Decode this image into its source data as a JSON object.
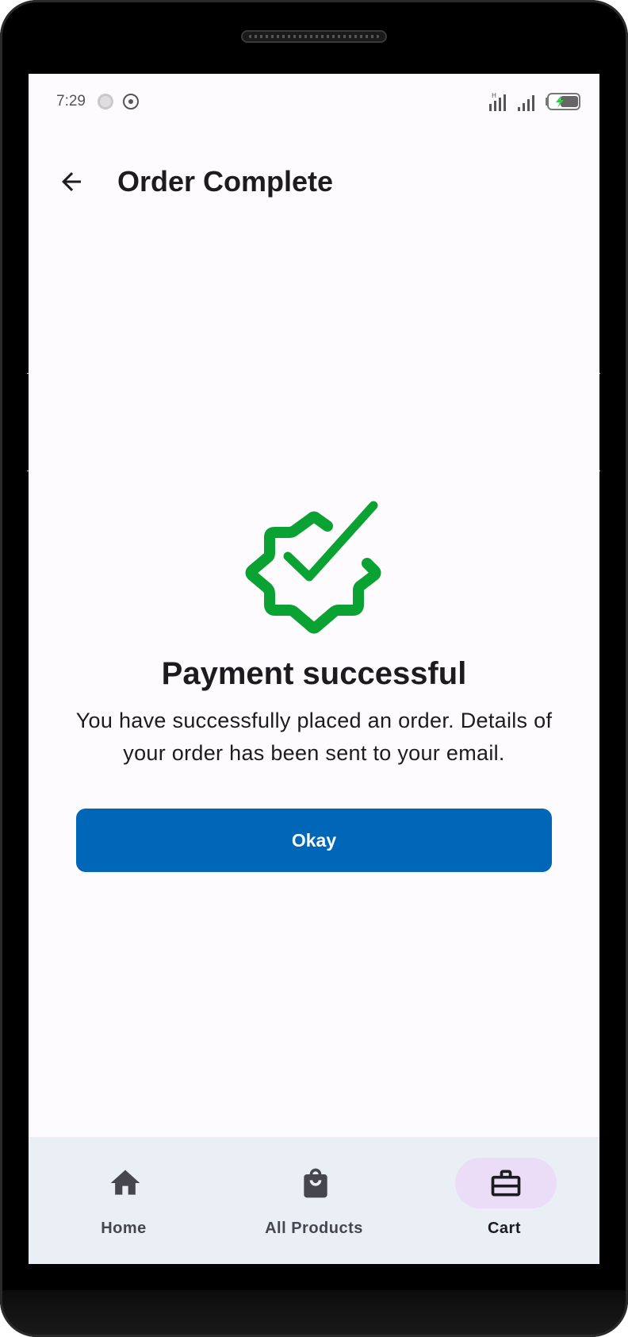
{
  "status_bar": {
    "time": "7:29"
  },
  "app_bar": {
    "title": "Order Complete",
    "back_icon": "arrow-left-icon"
  },
  "success": {
    "icon": "verified-badge-check-icon",
    "icon_color": "#0aa232",
    "title": "Payment successful",
    "message": "You have successfully placed an order. Details of your order has been sent to your email.",
    "button_label": "Okay",
    "button_color": "#0066b8"
  },
  "bottom_nav": {
    "active_index": 2,
    "items": [
      {
        "label": "Home",
        "icon": "home-icon"
      },
      {
        "label": "All Products",
        "icon": "shopping-bag-icon"
      },
      {
        "label": "Cart",
        "icon": "briefcase-icon"
      }
    ]
  },
  "colors": {
    "background": "#fefbfe",
    "nav_background": "#eaeef5",
    "nav_active_pill": "#ebddf7",
    "text": "#1c1b1f"
  }
}
